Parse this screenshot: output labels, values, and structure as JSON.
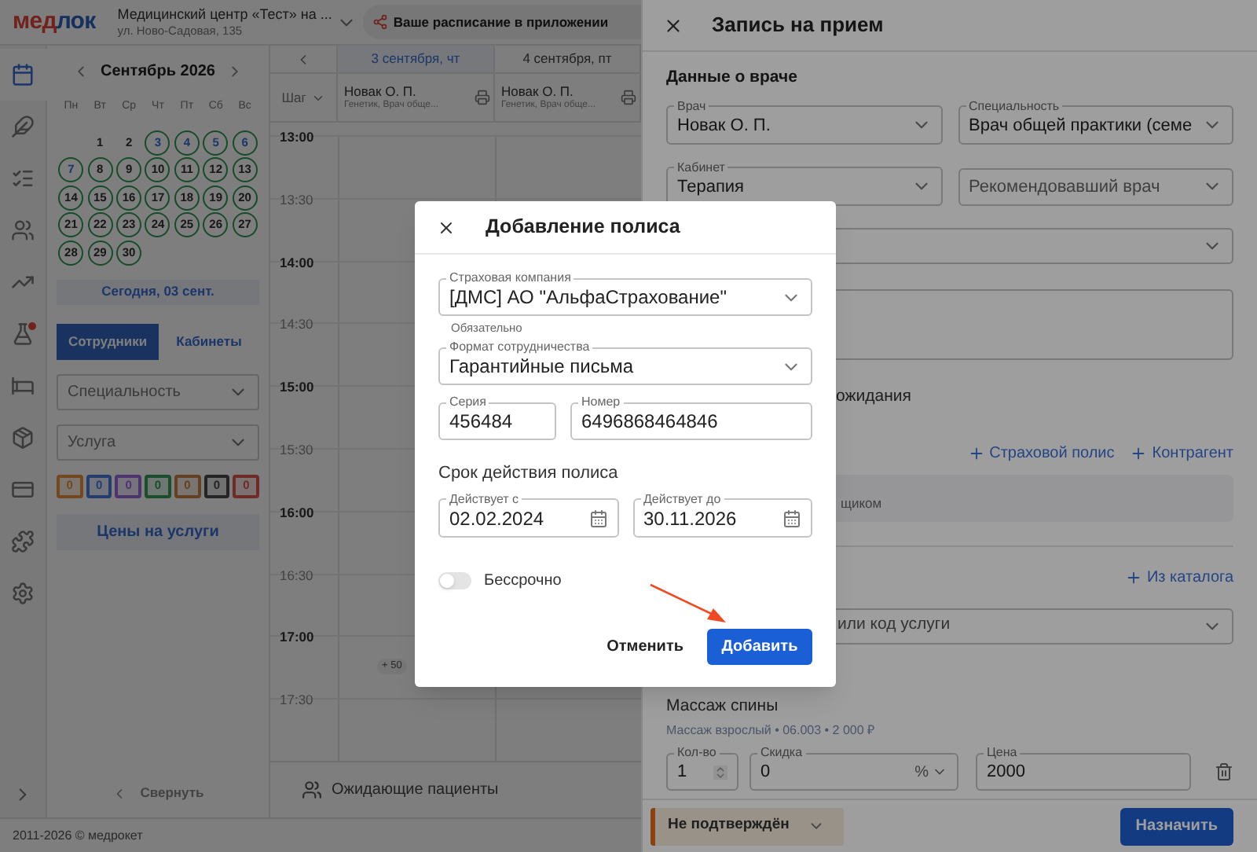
{
  "header": {
    "logo": {
      "accent": "мед",
      "rest": "лок"
    },
    "clinic": "Медицинский центр «Тест» на ...",
    "address": "ул. Ново-Садовая, 135",
    "app_promo": "Ваше расписание в приложении"
  },
  "nav_rail": [
    {
      "selected": true,
      "alert": false
    },
    {
      "selected": false,
      "alert": false
    },
    {
      "selected": false,
      "alert": false
    },
    {
      "selected": false,
      "alert": false
    },
    {
      "selected": false,
      "alert": false
    },
    {
      "selected": false,
      "alert": true
    },
    {
      "selected": false,
      "alert": false
    },
    {
      "selected": false,
      "alert": false
    },
    {
      "selected": false,
      "alert": false
    },
    {
      "selected": false,
      "alert": false
    },
    {
      "selected": false,
      "alert": false
    }
  ],
  "calendar": {
    "month": "Сентябрь 2026",
    "weekdays": [
      "Пн",
      "Вт",
      "Ср",
      "Чт",
      "Пт",
      "Сб",
      "Вс"
    ],
    "days": [
      {
        "day": "1",
        "available": false,
        "highlighted": false
      },
      {
        "day": "2",
        "available": false,
        "highlighted": false
      },
      {
        "day": "3",
        "available": true,
        "highlighted": true
      },
      {
        "day": "4",
        "available": true,
        "highlighted": true
      },
      {
        "day": "5",
        "available": true,
        "highlighted": true
      },
      {
        "day": "6",
        "available": true,
        "highlighted": true
      },
      {
        "day": "7",
        "available": true,
        "highlighted": true
      },
      {
        "day": "8",
        "available": true,
        "highlighted": false
      },
      {
        "day": "9",
        "available": true,
        "highlighted": false
      },
      {
        "day": "10",
        "available": true,
        "highlighted": false
      },
      {
        "day": "11",
        "available": true,
        "highlighted": false
      },
      {
        "day": "12",
        "available": true,
        "highlighted": false
      },
      {
        "day": "13",
        "available": true,
        "highlighted": false
      },
      {
        "day": "14",
        "available": true,
        "highlighted": false
      },
      {
        "day": "15",
        "available": true,
        "highlighted": false
      },
      {
        "day": "16",
        "available": true,
        "highlighted": false
      },
      {
        "day": "17",
        "available": true,
        "highlighted": false
      },
      {
        "day": "18",
        "available": true,
        "highlighted": false
      },
      {
        "day": "19",
        "available": true,
        "highlighted": false
      },
      {
        "day": "20",
        "available": true,
        "highlighted": false
      },
      {
        "day": "21",
        "available": true,
        "highlighted": false
      },
      {
        "day": "22",
        "available": true,
        "highlighted": false
      },
      {
        "day": "23",
        "available": true,
        "highlighted": false
      },
      {
        "day": "24",
        "available": true,
        "highlighted": false
      },
      {
        "day": "25",
        "available": true,
        "highlighted": false
      },
      {
        "day": "26",
        "available": true,
        "highlighted": false
      },
      {
        "day": "27",
        "available": true,
        "highlighted": false
      },
      {
        "day": "28",
        "available": true,
        "highlighted": false
      },
      {
        "day": "29",
        "available": true,
        "highlighted": false
      },
      {
        "day": "30",
        "available": true,
        "highlighted": false
      }
    ],
    "today_button": "Сегодня, 03 сент."
  },
  "staff_tabs": [
    {
      "label": "Сотрудники",
      "selected": true
    },
    {
      "label": "Кабинеты",
      "selected": false
    }
  ],
  "filters": [
    {
      "placeholder": "Специальность"
    },
    {
      "placeholder": "Услуга"
    }
  ],
  "counters": [
    {
      "count": "0",
      "color": "#74481f"
    },
    {
      "count": "0",
      "color": "#253d70"
    },
    {
      "count": "0",
      "color": "#4d3570"
    },
    {
      "count": "0",
      "color": "#1d4d2d"
    },
    {
      "count": "0",
      "color": "#644222"
    },
    {
      "count": "0",
      "color": "#252525"
    },
    {
      "count": "0",
      "color": "#702c27"
    }
  ],
  "prices_button": "Цены на услуги",
  "collapse_button": "Свернуть",
  "footer": "2011-2026 © медрокет",
  "schedule": {
    "dates": [
      {
        "label": "3 сентября, чт",
        "selected": true
      },
      {
        "label": "4 сентября, пт",
        "selected": false
      }
    ],
    "step": "Шаг",
    "doctors": [
      {
        "name": "Новак О. П.",
        "specialty": "Генетик, Врач обще..."
      },
      {
        "name": "Новак О. П.",
        "specialty": "Генетик, Врач обще..."
      }
    ],
    "times": [
      {
        "label": "13:00",
        "major": true
      },
      {
        "label": "13:30",
        "major": false
      },
      {
        "label": "14:00",
        "major": true
      },
      {
        "label": "14:30",
        "major": false
      },
      {
        "label": "15:00",
        "major": true
      },
      {
        "label": "15:30",
        "major": false
      },
      {
        "label": "16:00",
        "major": true
      },
      {
        "label": "16:30",
        "major": false
      },
      {
        "label": "17:00",
        "major": true
      },
      {
        "label": "17:30",
        "major": false
      }
    ],
    "more_chip": "+ 50",
    "waiting": "Ожидающие пациенты"
  },
  "appointment_panel": {
    "title": "Запись на прием",
    "section": "Данные о враче",
    "doctor": {
      "label": "Врач",
      "value": "Новак О. П."
    },
    "specialty": {
      "label": "Специальность",
      "value": "Врач общей практики (семе"
    },
    "room": {
      "label": "Кабинет",
      "value": "Терапия"
    },
    "referrer": {
      "placeholder": "Рекомендовавший врач"
    },
    "waitlist_fragment": "ожидания",
    "links": [
      "Страховой полис",
      "Контрагент"
    ],
    "payer_fragment": "щиком",
    "catalog_link": "Из каталога",
    "service_search": {
      "placeholder": "или код услуги"
    },
    "service": {
      "name": "Массаж спины",
      "details": "Массаж взрослый • 06.003 • 2 000 ₽",
      "quantity": {
        "label": "Кол-во",
        "value": "1"
      },
      "discount": {
        "label": "Скидка",
        "value": "0",
        "unit": "%"
      },
      "price": {
        "label": "Цена",
        "value": "2000"
      }
    },
    "status": "Не подтверждён",
    "submit": "Назначить"
  },
  "policy_dialog": {
    "title": "Добавление полиса",
    "company": {
      "label": "Страховая компания",
      "value": "[ДМС] АО \"АльфаСтрахование\"",
      "helper": "Обязательно"
    },
    "format": {
      "label": "Формат сотрудничества",
      "value": "Гарантийные письма"
    },
    "series": {
      "label": "Серия",
      "value": "456484"
    },
    "number": {
      "label": "Номер",
      "value": "6496868464846"
    },
    "validity_title": "Срок действия полиса",
    "valid_from": {
      "label": "Действует с",
      "value": "02.02.2024"
    },
    "valid_to": {
      "label": "Действует до",
      "value": "30.11.2026"
    },
    "indefinite": {
      "label": "Бессрочно",
      "on": false
    },
    "cancel": "Отменить",
    "add": "Добавить"
  }
}
